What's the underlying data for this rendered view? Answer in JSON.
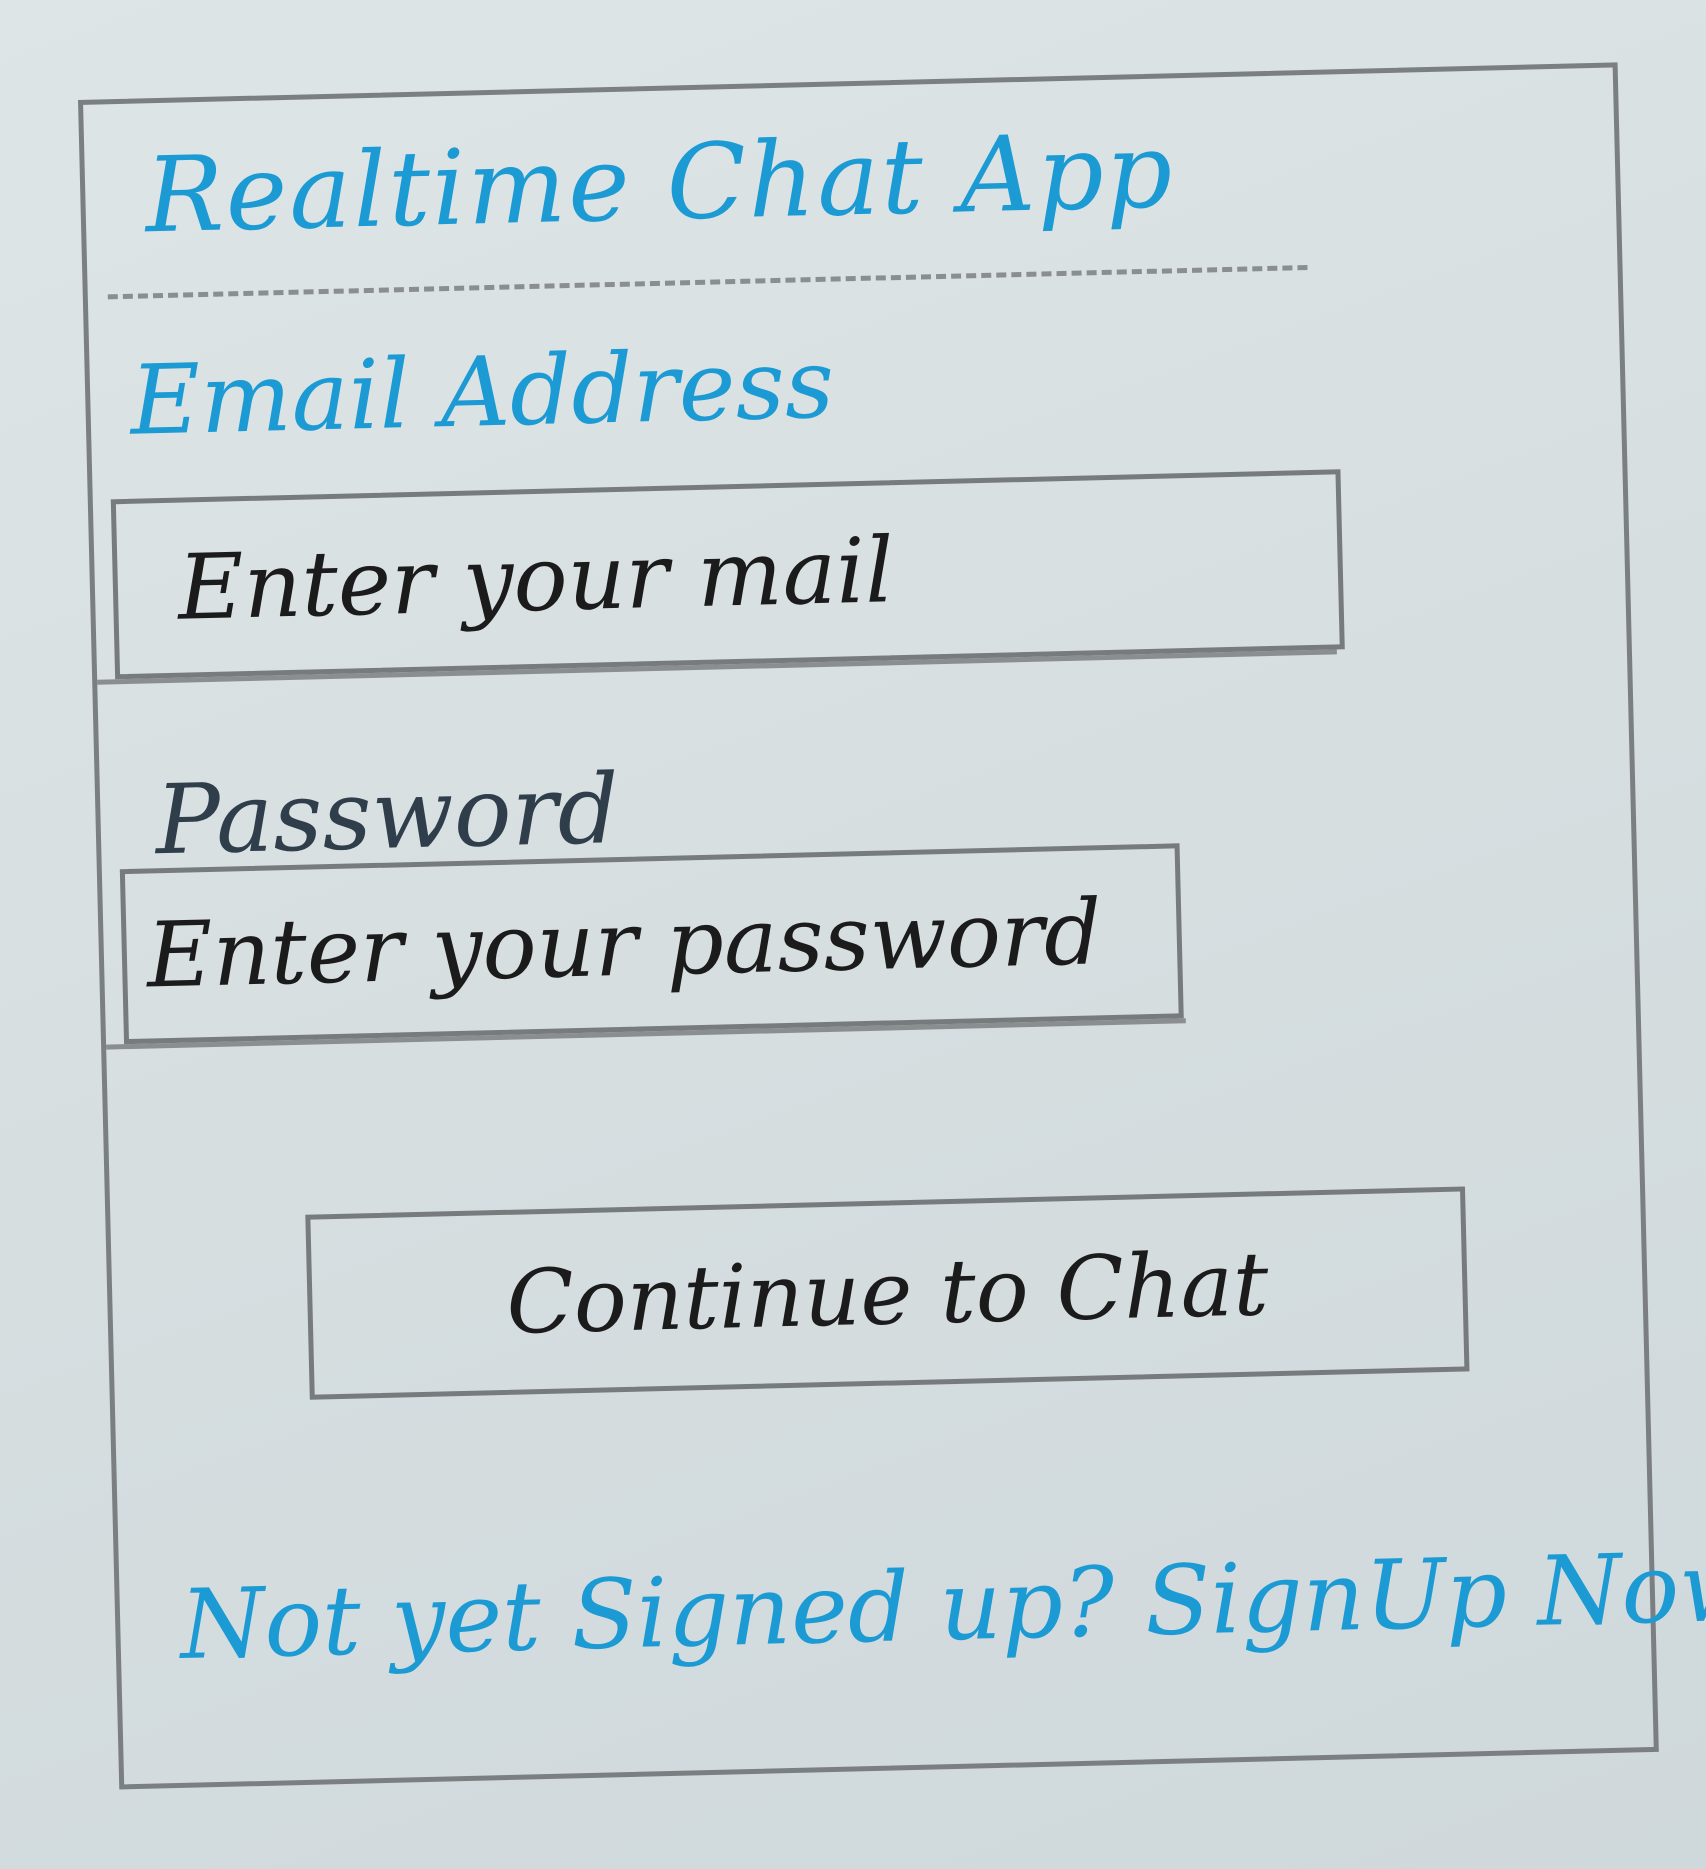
{
  "app": {
    "title": "Realtime Chat App"
  },
  "form": {
    "email": {
      "label": "Email Address",
      "placeholder": "Enter your mail"
    },
    "password": {
      "label": "Password",
      "placeholder": "Enter your password"
    },
    "submit_label": "Continue to Chat"
  },
  "footer": {
    "signup_text": "Not yet Signed up? SignUp Now"
  },
  "colors": {
    "accent": "#1c9ad4",
    "ink": "#1b1b1b",
    "pencil": "#7b7f82"
  }
}
